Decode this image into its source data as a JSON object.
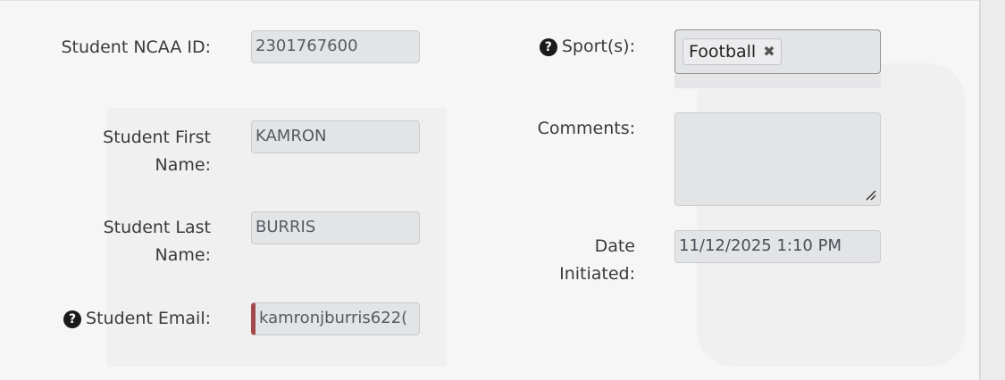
{
  "left_fields": {
    "ncaa_id": {
      "label": "Student NCAA ID:",
      "value": "2301767600"
    },
    "first_name": {
      "label": "Student First Name:",
      "value": "KAMRON"
    },
    "last_name": {
      "label": "Student Last Name:",
      "value": "BURRIS"
    },
    "email": {
      "label": "Student Email:",
      "value": "kamronjburris622("
    }
  },
  "right_fields": {
    "sports": {
      "label": "Sport(s):",
      "selected_tags": [
        "Football"
      ],
      "remove_glyph": "✖"
    },
    "comments": {
      "label": "Comments:",
      "value": ""
    },
    "date_initiated": {
      "label": "Date Initiated:",
      "value": "11/12/2025 1:10 PM"
    }
  },
  "icons": {
    "help": "question-circle-icon",
    "remove": "remove-tag-icon",
    "resize": "resize-grip-icon"
  },
  "colors": {
    "invalid_marker": "#a34a4a",
    "field_bg": "#e3e4e6",
    "label_text": "#3a3a3a",
    "help_icon": "#1a1a1a"
  }
}
